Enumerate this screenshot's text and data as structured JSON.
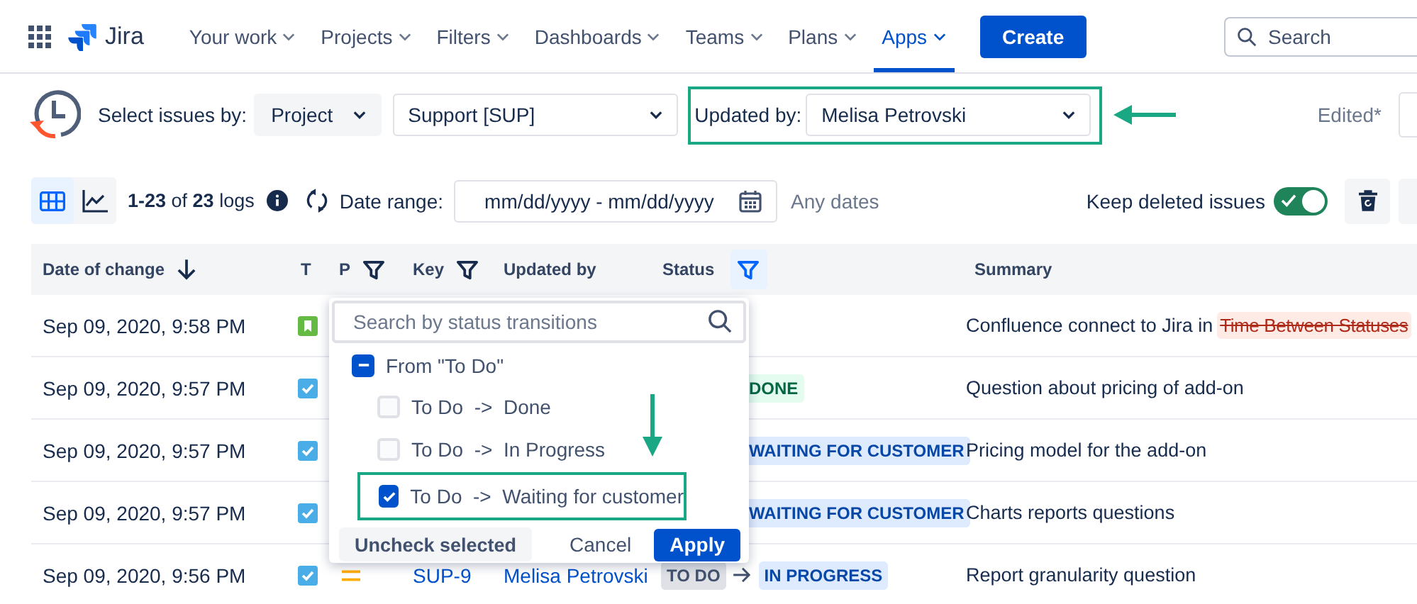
{
  "nav": {
    "product": "Jira",
    "items": [
      {
        "label": "Your work",
        "selected": false
      },
      {
        "label": "Projects",
        "selected": false
      },
      {
        "label": "Filters",
        "selected": false
      },
      {
        "label": "Dashboards",
        "selected": false
      },
      {
        "label": "Teams",
        "selected": false
      },
      {
        "label": "Plans",
        "selected": false
      },
      {
        "label": "Apps",
        "selected": true
      }
    ],
    "create": "Create",
    "search": {
      "placeholder": "Search"
    }
  },
  "selector": {
    "label": "Select issues by:",
    "mode": "Project",
    "project": "Support [SUP]",
    "updated_label": "Updated by:",
    "updated_value": "Melisa Petrovski",
    "edited": "Edited*"
  },
  "toolbar": {
    "views": [
      {
        "kind": "table",
        "selected": true
      },
      {
        "kind": "chart",
        "selected": false
      }
    ],
    "count": "**1-23** of **23** logs",
    "date_label": "Date range:",
    "date_value": "mm/dd/yyyy - mm/dd/yyyy",
    "any_dates": "Any dates",
    "keep_label": "Keep deleted issues",
    "keep_on": true
  },
  "table": {
    "columns": [
      {
        "label": "Date of change",
        "kind": "sort"
      },
      {
        "label": "T",
        "kind": "plain"
      },
      {
        "label": "P",
        "kind": "filter"
      },
      {
        "label": "Key",
        "kind": "filter"
      },
      {
        "label": "Updated by",
        "kind": "plain"
      },
      {
        "label": "Status",
        "kind": "filter_active"
      },
      {
        "label": "Summary",
        "kind": "plain"
      }
    ],
    "rows": [
      {
        "date": "Sep 09, 2020, 9:58 PM",
        "kind": "story",
        "summary": "Confluence connect to Jira in",
        "summary_deleted": "Time Between Statuses"
      },
      {
        "date": "Sep 09, 2020, 9:57 PM",
        "kind": "task",
        "status": {
          "to": "DONE",
          "color": "#e3fcef"
        },
        "summary": "Question about pricing of add-on"
      },
      {
        "date": "Sep 09, 2020, 9:57 PM",
        "kind": "task",
        "status": {
          "to": "WAITING FOR CUSTOMER",
          "color": "#deebff"
        },
        "summary": "Pricing model for the add-on"
      },
      {
        "date": "Sep 09, 2020, 9:57 PM",
        "kind": "task",
        "status": {
          "to": "WAITING FOR CUSTOMER",
          "color": "#deebff"
        },
        "summary": "Charts reports questions"
      },
      {
        "date": "Sep 09, 2020, 9:56 PM",
        "kind": "task",
        "priority": {
          "kind": "medium"
        },
        "key": "SUP-9",
        "updated_by": "Melisa Petrovski",
        "status": {
          "from": "TO DO",
          "to": "IN PROGRESS",
          "color": "#deebff"
        },
        "summary": "Report granularity question"
      }
    ]
  },
  "status_filter": {
    "placeholder": "Search by status transitions",
    "groups": [
      {
        "label": "From \"To Do\"",
        "indeterminate": true,
        "children": [
          {
            "label": "To Do  ->  Done",
            "checked": false
          },
          {
            "label": "To Do  ->  In Progress",
            "checked": false
          },
          {
            "label": "To Do  ->  Waiting for customer",
            "checked": true
          }
        ]
      }
    ],
    "uncheck": "Uncheck selected",
    "cancel": "Cancel",
    "apply": "Apply"
  }
}
